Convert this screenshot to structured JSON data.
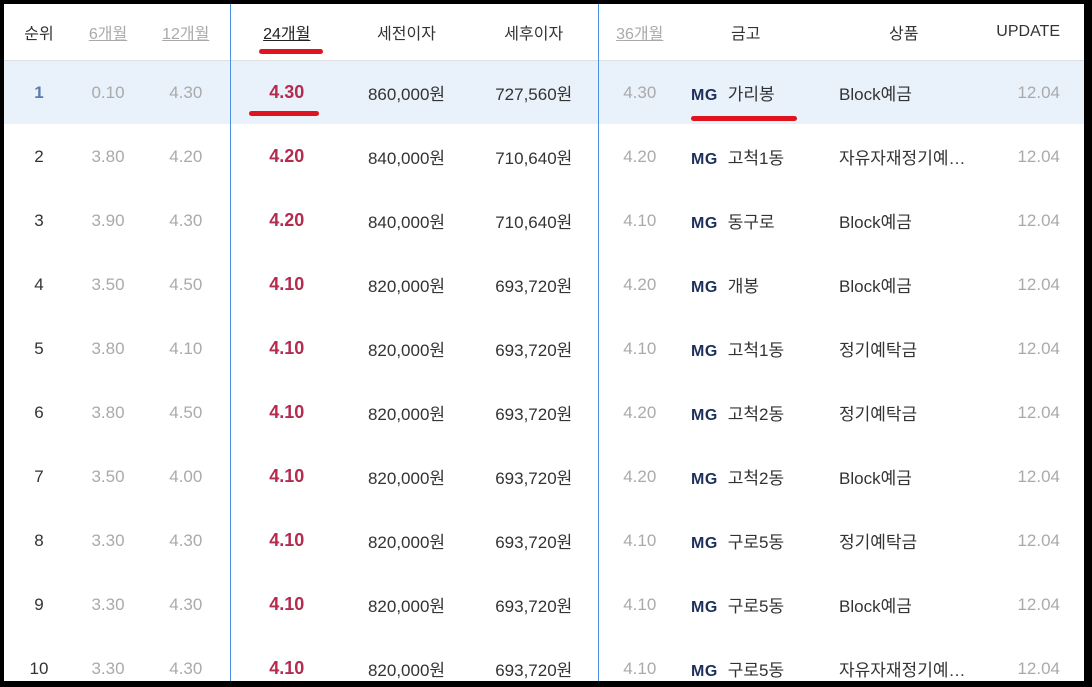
{
  "headers": {
    "rank": "순위",
    "m6": "6개월",
    "m12": "12개월",
    "m24": "24개월",
    "pretax": "세전이자",
    "aftertax": "세후이자",
    "m36": "36개월",
    "bank": "금고",
    "product": "상품",
    "update": "UPDATE"
  },
  "bank_prefix": "MG",
  "rows": [
    {
      "rank": "1",
      "m6": "0.10",
      "m12": "4.30",
      "m24": "4.30",
      "pretax": "860,000원",
      "aftertax": "727,560원",
      "m36": "4.30",
      "bank": "가리봉",
      "product": "Block예금",
      "update": "12.04"
    },
    {
      "rank": "2",
      "m6": "3.80",
      "m12": "4.20",
      "m24": "4.20",
      "pretax": "840,000원",
      "aftertax": "710,640원",
      "m36": "4.20",
      "bank": "고척1동",
      "product": "자유자재정기예…",
      "update": "12.04"
    },
    {
      "rank": "3",
      "m6": "3.90",
      "m12": "4.30",
      "m24": "4.20",
      "pretax": "840,000원",
      "aftertax": "710,640원",
      "m36": "4.10",
      "bank": "동구로",
      "product": "Block예금",
      "update": "12.04"
    },
    {
      "rank": "4",
      "m6": "3.50",
      "m12": "4.50",
      "m24": "4.10",
      "pretax": "820,000원",
      "aftertax": "693,720원",
      "m36": "4.20",
      "bank": "개봉",
      "product": "Block예금",
      "update": "12.04"
    },
    {
      "rank": "5",
      "m6": "3.80",
      "m12": "4.10",
      "m24": "4.10",
      "pretax": "820,000원",
      "aftertax": "693,720원",
      "m36": "4.10",
      "bank": "고척1동",
      "product": "정기예탁금",
      "update": "12.04"
    },
    {
      "rank": "6",
      "m6": "3.80",
      "m12": "4.50",
      "m24": "4.10",
      "pretax": "820,000원",
      "aftertax": "693,720원",
      "m36": "4.20",
      "bank": "고척2동",
      "product": "정기예탁금",
      "update": "12.04"
    },
    {
      "rank": "7",
      "m6": "3.50",
      "m12": "4.00",
      "m24": "4.10",
      "pretax": "820,000원",
      "aftertax": "693,720원",
      "m36": "4.20",
      "bank": "고척2동",
      "product": "Block예금",
      "update": "12.04"
    },
    {
      "rank": "8",
      "m6": "3.30",
      "m12": "4.30",
      "m24": "4.10",
      "pretax": "820,000원",
      "aftertax": "693,720원",
      "m36": "4.10",
      "bank": "구로5동",
      "product": "정기예탁금",
      "update": "12.04"
    },
    {
      "rank": "9",
      "m6": "3.30",
      "m12": "4.30",
      "m24": "4.10",
      "pretax": "820,000원",
      "aftertax": "693,720원",
      "m36": "4.10",
      "bank": "구로5동",
      "product": "Block예금",
      "update": "12.04"
    },
    {
      "rank": "10",
      "m6": "3.30",
      "m12": "4.30",
      "m24": "4.10",
      "pretax": "820,000원",
      "aftertax": "693,720원",
      "m36": "4.10",
      "bank": "구로5동",
      "product": "자유자재정기예…",
      "update": "12.04"
    }
  ],
  "colors": {
    "rate_highlight": "#b32b4f",
    "row_highlight_bg": "#e9f1fb",
    "column_divider": "#4a90e2",
    "annotation_mark": "#e0141e",
    "bank_prefix": "#1d2f5a"
  }
}
